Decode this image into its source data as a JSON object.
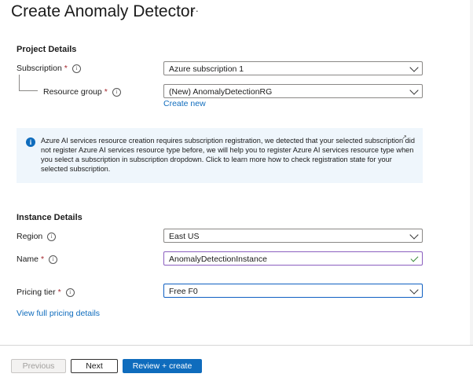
{
  "header": {
    "title": "Create Anomaly Detector",
    "more": "···"
  },
  "project": {
    "heading": "Project Details",
    "subscription": {
      "label": "Subscription",
      "required": "*",
      "value": "Azure subscription 1"
    },
    "resource_group": {
      "label": "Resource group",
      "required": "*",
      "value": "(New) AnomalyDetectionRG",
      "create_new": "Create new"
    }
  },
  "banner": {
    "text": "Azure AI services resource creation requires subscription registration, we detected that your selected subscription did not register Azure AI services resource type before, we will help you to register Azure AI services resource type when you select a subscription in subscription dropdown. Click to learn more how to check registration state for your selected subscription.",
    "icon": "info-icon",
    "ext_icon": "external-link-icon"
  },
  "instance": {
    "heading": "Instance Details",
    "region": {
      "label": "Region",
      "value": "East US"
    },
    "name": {
      "label": "Name",
      "required": "*",
      "value": "AnomalyDetectionInstance"
    },
    "pricing": {
      "label": "Pricing tier",
      "required": "*",
      "value": "Free F0",
      "view_link": "View full pricing details"
    }
  },
  "footer": {
    "previous": "Previous",
    "next": "Next",
    "review": "Review + create"
  },
  "colors": {
    "accent": "#0f6cbd",
    "required": "#a4262c",
    "banner_bg": "#eff6fc",
    "valid_border": "#8b5fbf"
  }
}
